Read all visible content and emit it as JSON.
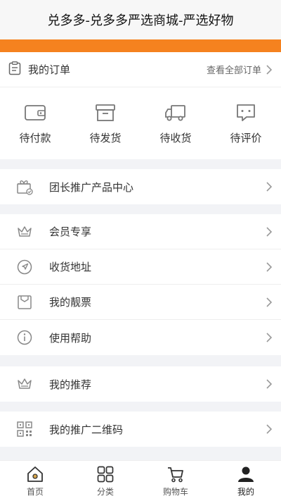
{
  "header": {
    "title": "兑多多-兑多多严选商城-严选好物"
  },
  "orders": {
    "title": "我的订单",
    "view_all": "查看全部订单",
    "items": [
      {
        "label": "待付款",
        "icon": "wallet-icon"
      },
      {
        "label": "待发货",
        "icon": "box-icon"
      },
      {
        "label": "待收货",
        "icon": "truck-icon"
      },
      {
        "label": "待评价",
        "icon": "comment-icon"
      }
    ]
  },
  "menu": {
    "group_buy": {
      "label": "团长推广产品中心",
      "icon": "gift-icon"
    },
    "member": {
      "label": "会员专享",
      "icon": "crown-icon"
    },
    "address": {
      "label": "收货地址",
      "icon": "location-icon"
    },
    "invoice": {
      "label": "我的靓票",
      "icon": "invoice-icon"
    },
    "help": {
      "label": "使用帮助",
      "icon": "info-icon"
    },
    "recommend": {
      "label": "我的推荐",
      "icon": "crown-icon"
    },
    "qrcode": {
      "label": "我的推广二维码",
      "icon": "qrcode-icon"
    }
  },
  "tabbar": {
    "items": [
      {
        "label": "首页",
        "icon": "home-icon"
      },
      {
        "label": "分类",
        "icon": "grid-icon"
      },
      {
        "label": "购物车",
        "icon": "cart-icon"
      },
      {
        "label": "我的",
        "icon": "user-icon",
        "active": true
      }
    ]
  },
  "colors": {
    "accent": "#f5821f",
    "icon": "#888888"
  }
}
